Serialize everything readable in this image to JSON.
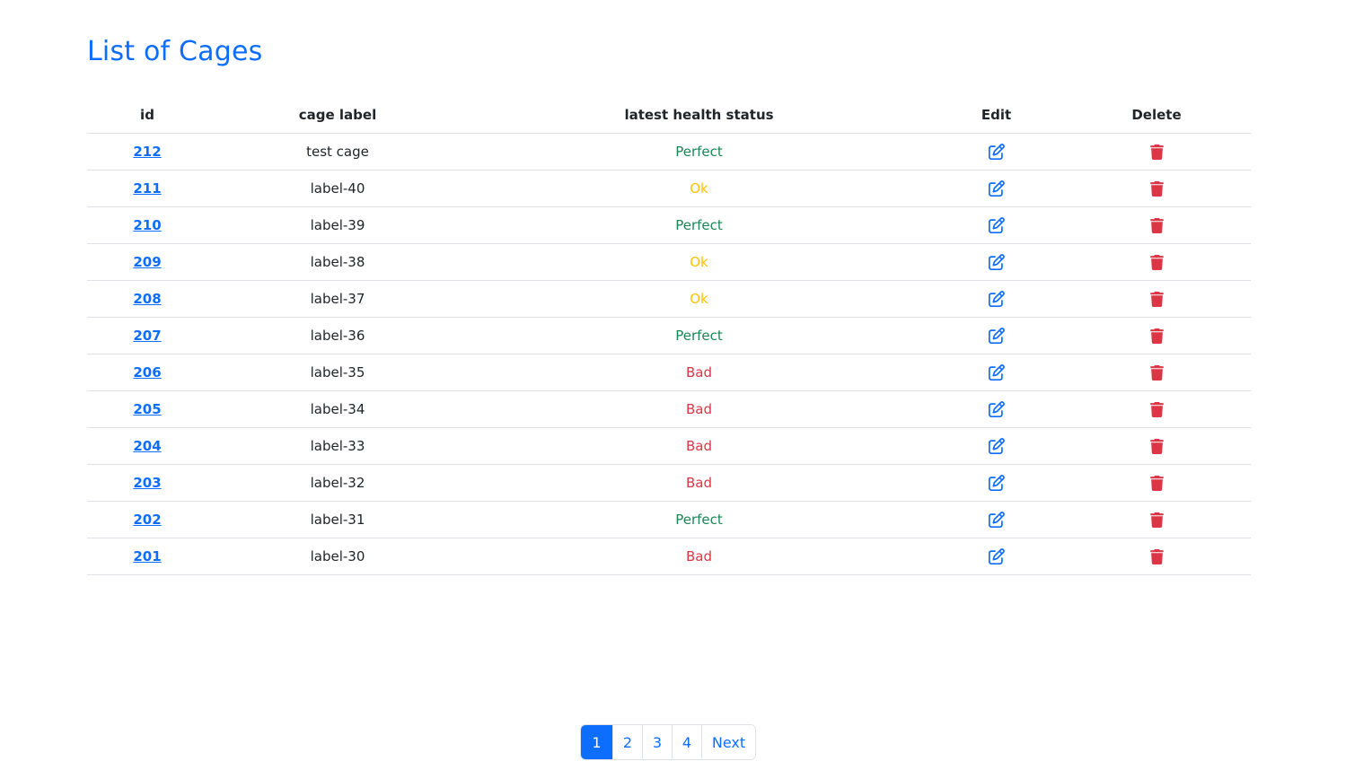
{
  "page": {
    "title": "List of Cages"
  },
  "table": {
    "headers": {
      "id": "id",
      "label": "cage label",
      "status": "latest health status",
      "edit": "Edit",
      "delete": "Delete"
    },
    "rows": [
      {
        "id": "212",
        "label": "test cage",
        "status": "Perfect",
        "status_color": "#198754"
      },
      {
        "id": "211",
        "label": "label-40",
        "status": "Ok",
        "status_color": "#ffc107"
      },
      {
        "id": "210",
        "label": "label-39",
        "status": "Perfect",
        "status_color": "#198754"
      },
      {
        "id": "209",
        "label": "label-38",
        "status": "Ok",
        "status_color": "#ffc107"
      },
      {
        "id": "208",
        "label": "label-37",
        "status": "Ok",
        "status_color": "#ffc107"
      },
      {
        "id": "207",
        "label": "label-36",
        "status": "Perfect",
        "status_color": "#198754"
      },
      {
        "id": "206",
        "label": "label-35",
        "status": "Bad",
        "status_color": "#dc3545"
      },
      {
        "id": "205",
        "label": "label-34",
        "status": "Bad",
        "status_color": "#dc3545"
      },
      {
        "id": "204",
        "label": "label-33",
        "status": "Bad",
        "status_color": "#dc3545"
      },
      {
        "id": "203",
        "label": "label-32",
        "status": "Bad",
        "status_color": "#dc3545"
      },
      {
        "id": "202",
        "label": "label-31",
        "status": "Perfect",
        "status_color": "#198754"
      },
      {
        "id": "201",
        "label": "label-30",
        "status": "Bad",
        "status_color": "#dc3545"
      }
    ],
    "edit_icon": "edit-icon",
    "delete_icon": "trash-icon"
  },
  "pagination": {
    "pages": [
      "1",
      "2",
      "3",
      "4"
    ],
    "active_page": "1",
    "next_label": "Next"
  },
  "colors": {
    "accent": "#0d6efd",
    "perfect": "#198754",
    "ok": "#ffc107",
    "bad": "#dc3545"
  }
}
